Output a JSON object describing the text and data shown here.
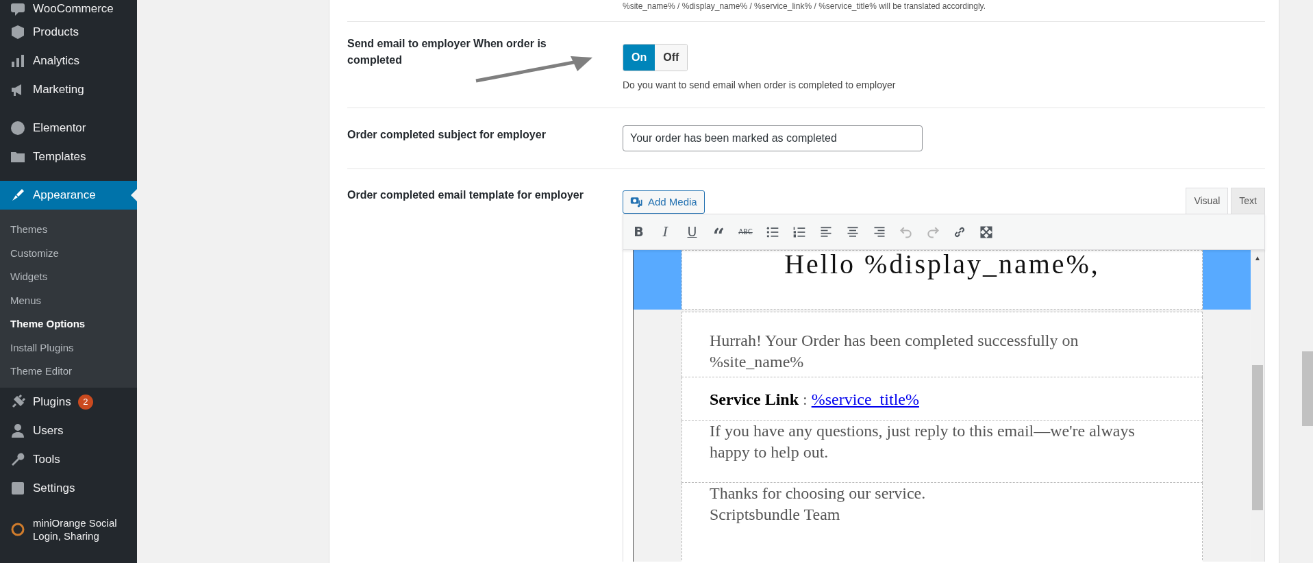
{
  "sidebar": {
    "items": [
      {
        "label": "WooCommerce",
        "kind": "woo",
        "selected": false
      },
      {
        "label": "Products",
        "kind": "box",
        "selected": false
      },
      {
        "label": "Analytics",
        "kind": "bars",
        "selected": false
      },
      {
        "label": "Marketing",
        "kind": "megaphone",
        "selected": false
      },
      {
        "label": "Elementor",
        "kind": "elementor",
        "selected": false
      },
      {
        "label": "Templates",
        "kind": "folder",
        "selected": false
      },
      {
        "label": "Appearance",
        "kind": "brush",
        "selected": true,
        "children": [
          {
            "label": "Themes",
            "selected": false
          },
          {
            "label": "Customize",
            "selected": false
          },
          {
            "label": "Widgets",
            "selected": false
          },
          {
            "label": "Menus",
            "selected": false
          },
          {
            "label": "Theme Options",
            "selected": true
          },
          {
            "label": "Install Plugins",
            "selected": false
          },
          {
            "label": "Theme Editor",
            "selected": false
          }
        ]
      },
      {
        "label": "Plugins",
        "kind": "plug",
        "selected": false,
        "badge": "2"
      },
      {
        "label": "Users",
        "kind": "user",
        "selected": false
      },
      {
        "label": "Tools",
        "kind": "wrench",
        "selected": false
      },
      {
        "label": "Settings",
        "kind": "sliders",
        "selected": false
      },
      {
        "label": "miniOrange Social Login, Sharing",
        "kind": "orange",
        "selected": false
      }
    ]
  },
  "top_note": "%site_name% / %display_name% / %service_link% / %service_title% will be translated accordingly.",
  "settings": [
    {
      "kind": "toggle",
      "label": "Send email to employer When order is completed",
      "options": [
        {
          "label": "On",
          "selected": true
        },
        {
          "label": "Off",
          "selected": false
        }
      ],
      "help": "Do you want to send email when order is completed to employer"
    },
    {
      "kind": "text",
      "label": "Order completed subject for employer",
      "value": "Your order has been marked as completed"
    },
    {
      "kind": "editor",
      "label": "Order completed email template for employer",
      "add_media": "Add Media",
      "tabs": [
        {
          "label": "Visual",
          "selected": true
        },
        {
          "label": "Text",
          "selected": false
        }
      ],
      "toolbar": [
        {
          "kind": "bold",
          "label": "B",
          "disabled": false
        },
        {
          "kind": "italic",
          "label": "I",
          "disabled": false
        },
        {
          "kind": "underline",
          "label": "U",
          "disabled": false
        },
        {
          "kind": "quote",
          "label": "“",
          "disabled": false
        },
        {
          "kind": "strike",
          "label": "ABC",
          "disabled": false
        },
        {
          "kind": "bullets",
          "disabled": false
        },
        {
          "kind": "numbers",
          "disabled": false
        },
        {
          "kind": "align-left",
          "disabled": false
        },
        {
          "kind": "align-center",
          "disabled": false
        },
        {
          "kind": "align-right",
          "disabled": false
        },
        {
          "kind": "undo",
          "disabled": true
        },
        {
          "kind": "redo",
          "disabled": true
        },
        {
          "kind": "link",
          "disabled": false
        },
        {
          "kind": "fullscreen",
          "disabled": false
        }
      ],
      "scroll_up": "▲",
      "email": {
        "heading": "Hello %display_name%,",
        "intro": "Hurrah! Your Order has been completed successfully on %site_name%",
        "service_label": "Service Link",
        "separator": ":",
        "service_link": "%service_title%",
        "questions": "If you have any questions, just reply to this email—we're always happy to help out.",
        "closing": [
          "Thanks for choosing our service.",
          "Scriptsbundle Team"
        ]
      }
    }
  ]
}
